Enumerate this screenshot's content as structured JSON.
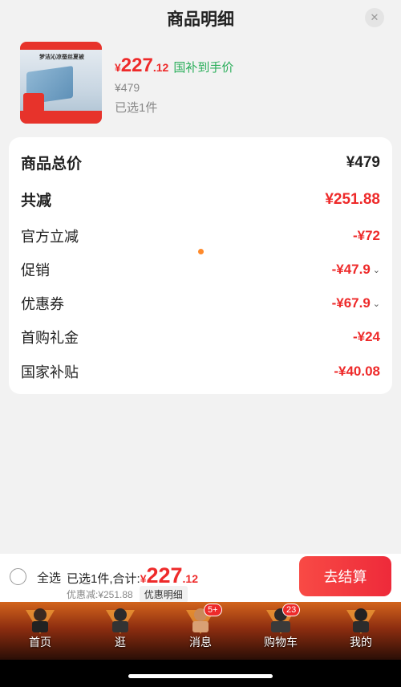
{
  "sheet": {
    "title": "商品明细",
    "close_icon": "close-icon"
  },
  "product": {
    "thumb_title": "梦洁沁凉蚕丝夏被",
    "price_symbol": "¥",
    "price_int": "227",
    "price_dec": ".12",
    "subsidy_label": "国补到手价",
    "original_price": "¥479",
    "selected_qty": "已选1件"
  },
  "details": {
    "rows": [
      {
        "label": "商品总价",
        "value": "¥479"
      },
      {
        "label": "共减",
        "value": "¥251.88"
      },
      {
        "label": "官方立减",
        "value": "-¥72"
      },
      {
        "label": "促销",
        "value": "-¥47.9"
      },
      {
        "label": "优惠券",
        "value": "-¥67.9"
      },
      {
        "label": "首购礼金",
        "value": "-¥24"
      },
      {
        "label": "国家补贴",
        "value": "-¥40.08"
      }
    ]
  },
  "checkout": {
    "select_all": "全选",
    "summary_prefix": "已选1件,合计:",
    "total_symbol": "¥",
    "total_int": "227",
    "total_dec": ".12",
    "discount_text": "优惠减:¥251.88",
    "detail_link": "优惠明细",
    "checkout_button": "去结算"
  },
  "tabbar": {
    "items": [
      {
        "label": "首页",
        "badge": ""
      },
      {
        "label": "逛",
        "badge": ""
      },
      {
        "label": "消息",
        "badge": "5+"
      },
      {
        "label": "购物车",
        "badge": "23"
      },
      {
        "label": "我的",
        "badge": ""
      }
    ]
  },
  "colors": {
    "accent": "#ee2a2a",
    "subsidy": "#2aae5a",
    "dot": "#ff8a2b"
  }
}
